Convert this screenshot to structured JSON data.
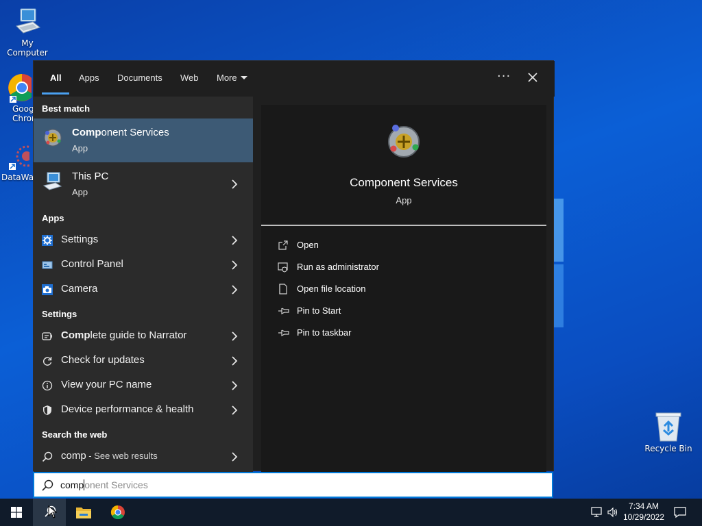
{
  "desktop": {
    "icons": [
      {
        "label": "My Computer",
        "icon": "computer-icon"
      },
      {
        "label": "Goog\nChrom",
        "icon": "chrome-icon"
      },
      {
        "label": "DataWag",
        "icon": "datawag-icon"
      },
      {
        "label": "Recycle Bin",
        "icon": "recycle-bin-icon"
      }
    ]
  },
  "search_window": {
    "tabs": [
      {
        "label": "All",
        "active": true
      },
      {
        "label": "Apps"
      },
      {
        "label": "Documents"
      },
      {
        "label": "Web"
      },
      {
        "label": "More"
      }
    ],
    "more_icon": "ellipsis-icon",
    "close_icon": "close-icon",
    "accent_color": "#4aa0f0",
    "selected_color": "#3d5a75"
  },
  "left": {
    "best_match_header": "Best match",
    "best_match": [
      {
        "title_bold": "Comp",
        "title_rest": "onent Services",
        "subtitle": "App",
        "icon": "component-services-icon",
        "selected": true
      },
      {
        "title_bold": "",
        "title_rest": "This PC",
        "subtitle": "App",
        "icon": "this-pc-icon"
      }
    ],
    "apps_header": "Apps",
    "apps": [
      {
        "label": "Settings",
        "icon": "settings-gear-icon"
      },
      {
        "label": "Control Panel",
        "icon": "control-panel-icon"
      },
      {
        "label": "Camera",
        "icon": "camera-icon"
      }
    ],
    "settings_header": "Settings",
    "settings": [
      {
        "label_bold": "Comp",
        "label_rest": "lete guide to Narrator",
        "icon": "narrator-icon"
      },
      {
        "label_bold": "",
        "label_rest": "Check for updates",
        "icon": "refresh-icon"
      },
      {
        "label_bold": "",
        "label_rest": "View your PC name",
        "icon": "info-icon"
      },
      {
        "label_bold": "",
        "label_rest": "Device performance & health",
        "icon": "shield-icon"
      }
    ],
    "web_header": "Search the web",
    "web": {
      "query": "comp",
      "suffix": " - See web results",
      "icon": "search-icon"
    }
  },
  "right": {
    "title": "Component Services",
    "subtitle": "App",
    "actions": [
      {
        "label": "Open",
        "icon": "open-icon"
      },
      {
        "label": "Run as administrator",
        "icon": "run-admin-icon"
      },
      {
        "label": "Open file location",
        "icon": "file-location-icon"
      },
      {
        "label": "Pin to Start",
        "icon": "pin-icon"
      },
      {
        "label": "Pin to taskbar",
        "icon": "pin-icon"
      }
    ]
  },
  "searchbox": {
    "typed": "comp",
    "suggestion": "onent Services",
    "icon": "search-icon"
  },
  "taskbar": {
    "time": "7:34 AM",
    "date": "10/29/2022"
  }
}
